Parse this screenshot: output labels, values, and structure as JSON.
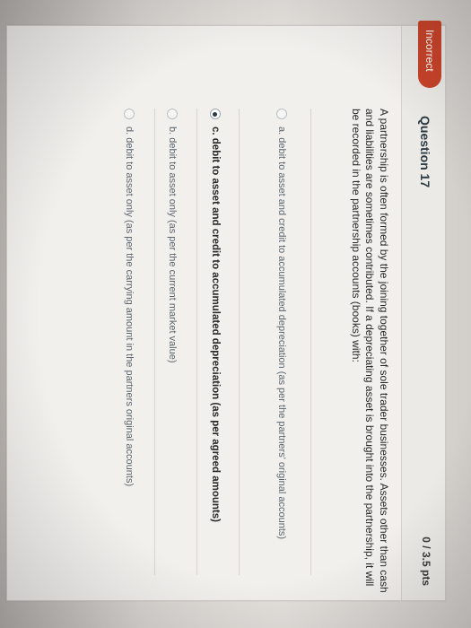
{
  "header": {
    "badge": "Incorrect",
    "title": "Question 17",
    "points": "0 / 3.5 pts"
  },
  "question": {
    "text": "A partnership is often formed by the joining together of sole trader businesses. Assets other than cash and liabilities are sometimes contributed. If a depreciating asset is brought into the partnership, it will be recorded in the partnership accounts (books) with:"
  },
  "answers": [
    {
      "label": "a. debit to asset and credit to accumulated depreciation (as per the partners' original accounts)",
      "selected": false
    },
    {
      "label": "c. debit to asset and credit to accumulated depreciation (as per agreed amounts)",
      "selected": true
    },
    {
      "label": "b. debit to asset only (as per the current market value)",
      "selected": false
    },
    {
      "label": "d. debit to asset only (as per the carrying amount in the partners original accounts)",
      "selected": false
    }
  ],
  "colors": {
    "incorrect_badge": "#c8432a",
    "card_background": "#f2f0ed",
    "title_text": "#2d3b45"
  }
}
